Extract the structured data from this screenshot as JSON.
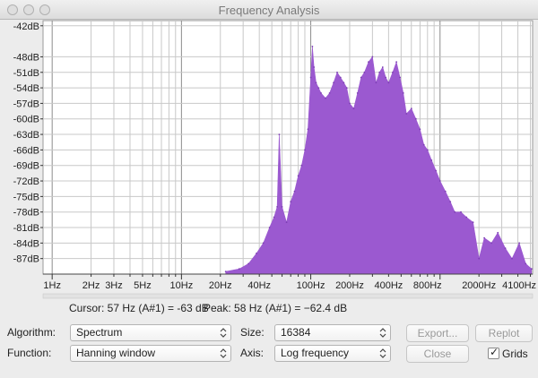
{
  "window": {
    "title": "Frequency Analysis"
  },
  "readout": {
    "cursor": "Cursor: 57 Hz (A#1) = -63 dB",
    "peak": "Peak: 58 Hz (A#1) = −62.4 dB"
  },
  "controls": {
    "algorithm_label": "Algorithm:",
    "algorithm_value": "Spectrum",
    "function_label": "Function:",
    "function_value": "Hanning window",
    "size_label": "Size:",
    "size_value": "16384",
    "axis_label": "Axis:",
    "axis_value": "Log frequency",
    "export_label": "Export...",
    "replot_label": "Replot",
    "close_label": "Close",
    "grids_label": "Grids",
    "grids_checked": true
  },
  "chart_data": {
    "type": "area",
    "color": "#9b59d0",
    "grid": true,
    "x_scale": "log",
    "xlim": [
      0.85,
      5200
    ],
    "ylim": [
      -90,
      -41
    ],
    "y_ticks": [
      "-42dB",
      "-48dB",
      "-51dB",
      "-54dB",
      "-57dB",
      "-60dB",
      "-63dB",
      "-66dB",
      "-69dB",
      "-72dB",
      "-75dB",
      "-78dB",
      "-81dB",
      "-84dB",
      "-87dB"
    ],
    "x_ticks": [
      {
        "label": "1Hz",
        "value": 1
      },
      {
        "label": "2Hz",
        "value": 2
      },
      {
        "label": "3Hz",
        "value": 3
      },
      {
        "label": "5Hz",
        "value": 5
      },
      {
        "label": "10Hz",
        "value": 10
      },
      {
        "label": "20Hz",
        "value": 20
      },
      {
        "label": "40Hz",
        "value": 40
      },
      {
        "label": "100Hz",
        "value": 100
      },
      {
        "label": "200Hz",
        "value": 200
      },
      {
        "label": "400Hz",
        "value": 400
      },
      {
        "label": "800Hz",
        "value": 800
      },
      {
        "label": "2000Hz",
        "value": 2000
      },
      {
        "label": "4100Hz",
        "value": 4100
      }
    ],
    "x": [
      22,
      28,
      33,
      38,
      43,
      48,
      52,
      55,
      57,
      60,
      65,
      70,
      75,
      80,
      85,
      90,
      95,
      100,
      103,
      106,
      110,
      115,
      120,
      130,
      140,
      150,
      160,
      170,
      180,
      190,
      200,
      215,
      230,
      245,
      260,
      280,
      300,
      320,
      340,
      360,
      380,
      400,
      430,
      460,
      490,
      520,
      550,
      600,
      650,
      700,
      750,
      800,
      860,
      930,
      1000,
      1100,
      1200,
      1300,
      1450,
      1600,
      1800,
      2000,
      2200,
      2500,
      2800,
      3200,
      3600,
      4100,
      4600,
      5100
    ],
    "values": [
      -89.5,
      -89,
      -88,
      -86,
      -84,
      -81,
      -79,
      -77,
      -63,
      -77,
      -80,
      -76,
      -74,
      -71,
      -69,
      -66,
      -62,
      -52,
      -46,
      -50,
      -53,
      -54,
      -55,
      -56,
      -55,
      -53,
      -51,
      -52,
      -53,
      -54,
      -57,
      -58,
      -55,
      -52,
      -51,
      -49,
      -48,
      -53,
      -51,
      -50,
      -52,
      -53,
      -51,
      -49,
      -52,
      -55,
      -59,
      -58,
      -60,
      -62,
      -65,
      -66,
      -68,
      -70,
      -72,
      -74,
      -76,
      -78,
      -78,
      -79,
      -80,
      -87,
      -83,
      -84,
      -82,
      -85,
      -87,
      -84,
      -88,
      -89
    ]
  }
}
